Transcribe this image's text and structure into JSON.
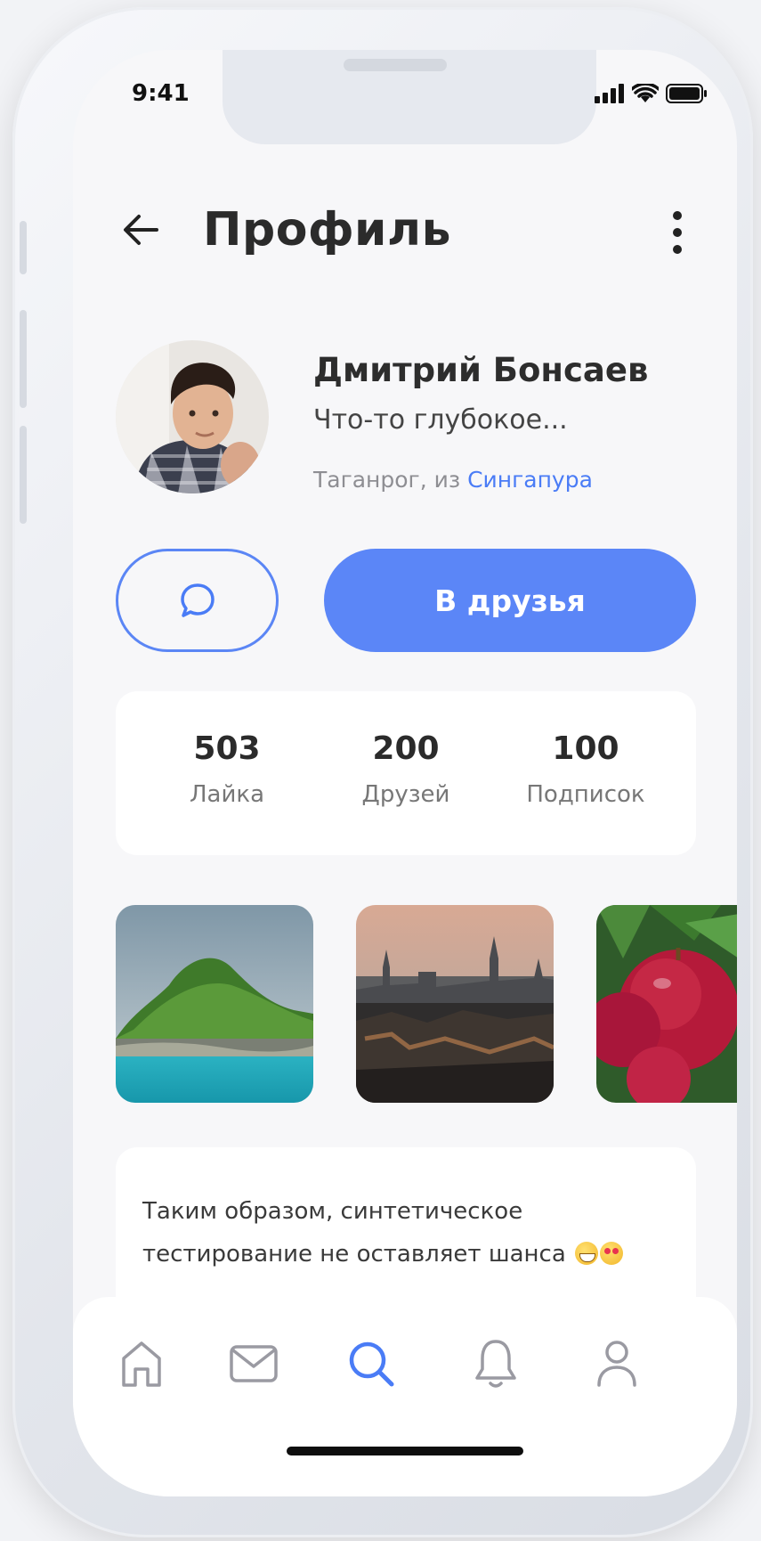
{
  "status_bar": {
    "time": "9:41"
  },
  "header": {
    "title": "Профиль"
  },
  "profile": {
    "name": "Дмитрий Бонсаев",
    "status": "Что-то глубокое...",
    "location_prefix": "Таганрог, из ",
    "location_link": "Сингапура"
  },
  "actions": {
    "add_friend_label": "В друзья"
  },
  "stats": [
    {
      "value": "503",
      "label": "Лайка"
    },
    {
      "value": "200",
      "label": "Друзей"
    },
    {
      "value": "100",
      "label": "Подписок"
    }
  ],
  "post": {
    "text_line1": "Таким образом, синтетическое",
    "text_line2": "тестирование не оставляет шанса"
  },
  "tab_bar": {
    "active_tab": "search",
    "active_color": "#4a7cf6",
    "inactive_color": "#9a9aa2"
  },
  "colors": {
    "accent": "#5b86f7",
    "link": "#4a7cf6"
  }
}
